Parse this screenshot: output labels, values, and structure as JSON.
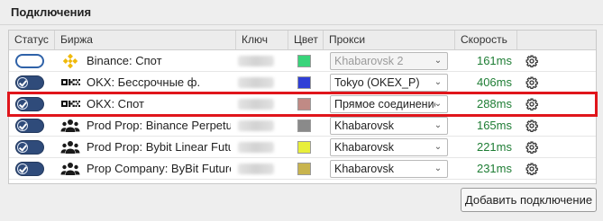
{
  "panel": {
    "title": "Подключения"
  },
  "columns": {
    "status": "Статус",
    "exchange": "Биржа",
    "key": "Ключ",
    "color": "Цвет",
    "proxy": "Прокси",
    "speed": "Скорость"
  },
  "rows": [
    {
      "enabled": false,
      "icon": "binance-icon",
      "exchange": "Binance: Спот",
      "color": "#39d47a",
      "proxy": "Khabarovsk 2",
      "proxy_disabled": true,
      "speed": "161ms",
      "highlighted": false
    },
    {
      "enabled": true,
      "icon": "okx-icon",
      "exchange": "OKX: Бессрочные ф.",
      "color": "#2f3fd6",
      "proxy": "Tokyo (OKEX_P)",
      "proxy_disabled": false,
      "speed": "406ms",
      "highlighted": false
    },
    {
      "enabled": true,
      "icon": "okx-icon",
      "exchange": "OKX: Спот",
      "color": "#c08a85",
      "proxy": "Прямое соединение",
      "proxy_disabled": false,
      "speed": "288ms",
      "highlighted": true
    },
    {
      "enabled": true,
      "icon": "group-icon",
      "exchange": "Prod Prop: Binance Perpetual",
      "color": "#8a8a8a",
      "proxy": "Khabarovsk",
      "proxy_disabled": false,
      "speed": "165ms",
      "highlighted": false
    },
    {
      "enabled": true,
      "icon": "group-icon",
      "exchange": "Prod Prop: Bybit Linear Futures",
      "color": "#e8ef3a",
      "proxy": "Khabarovsk",
      "proxy_disabled": false,
      "speed": "221ms",
      "highlighted": false
    },
    {
      "enabled": true,
      "icon": "group-icon",
      "exchange": "Prop Company: ByBit Futures",
      "color": "#c8b44e",
      "proxy": "Khabarovsk",
      "proxy_disabled": false,
      "speed": "231ms",
      "highlighted": false
    }
  ],
  "actions": {
    "add_connection": "Добавить подключение"
  },
  "colors": {
    "toggle_on": "#2f4b7a",
    "speed_text": "#1e7d34",
    "highlight_border": "#e0151b",
    "binance": "#f0b90b"
  }
}
